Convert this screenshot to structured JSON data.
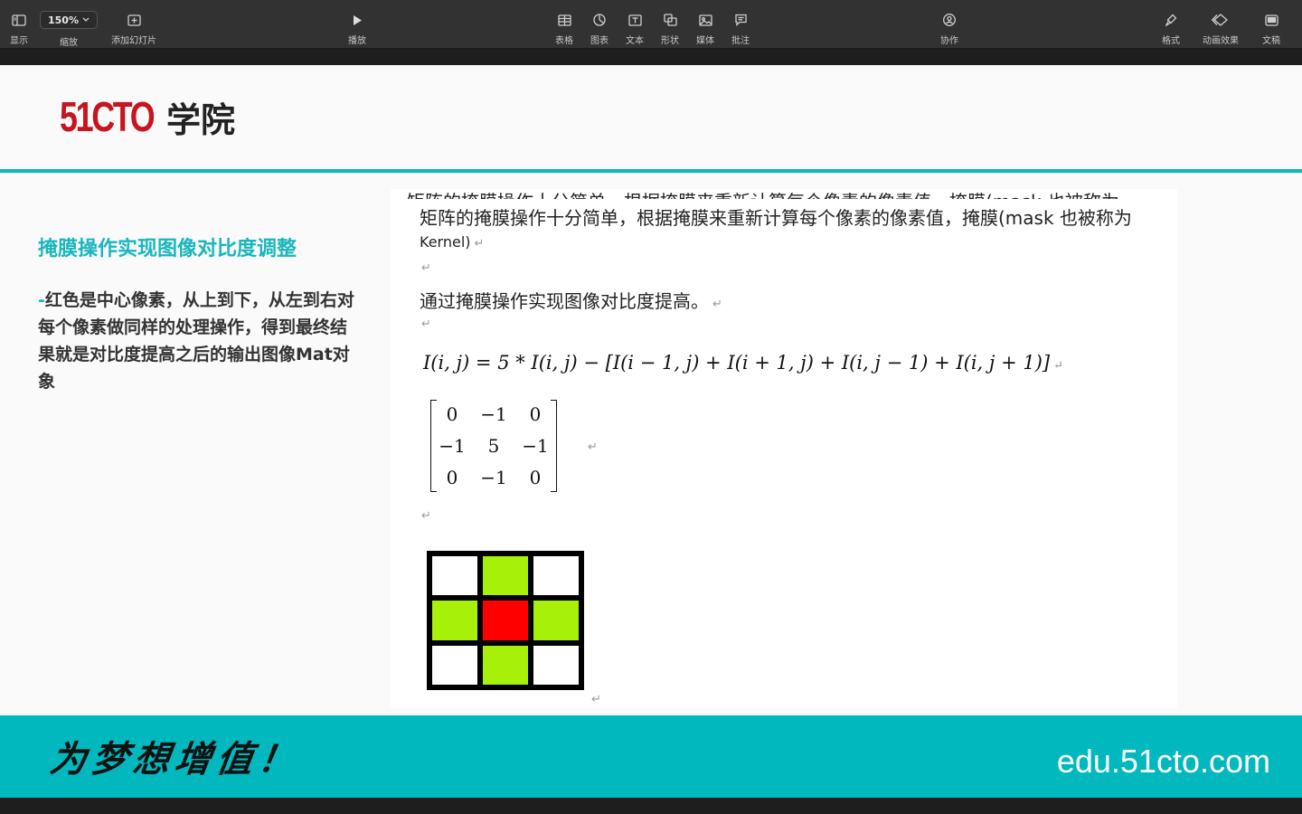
{
  "toolbar": {
    "view_label": "显示",
    "zoom_value": "150%",
    "zoom_label": "缩放",
    "add_slide_label": "添加幻灯片",
    "play_label": "播放",
    "table_label": "表格",
    "chart_label": "图表",
    "text_label": "文本",
    "shape_label": "形状",
    "media_label": "媒体",
    "comment_label": "批注",
    "collaborate_label": "协作",
    "format_label": "格式",
    "animate_label": "动画效果",
    "document_label": "文稿"
  },
  "slide": {
    "logo_number": "51CTO",
    "logo_text": "学院",
    "title": "掩膜操作实现图像对比度调整",
    "body_dash": "-",
    "body_text": "红色是中心像素，从上到下，从左到右对每个像素做同样的处理操作，得到最终结果就是对比度提高之后的输出图像Mat对象",
    "doc": {
      "cut_line": "矩阵的掩膜操作十分简单，根据掩膜来重新计算每个像素的像素值，掩膜(mask 也被称为",
      "line1": "矩阵的掩膜操作十分简单，根据掩膜来重新计算每个像素的像素值，掩膜(mask 也被称为",
      "line2": "Kernel)",
      "line3": "通过掩膜操作实现图像对比度提高。",
      "return_mark": "↵",
      "formula": "I(i, j) = 5 * I(i, j) − [I(i − 1, j) + I(i + 1, j) + I(i, j − 1) + I(i, j + 1)]",
      "matrix": [
        "0",
        "−1",
        "0",
        "−1",
        "5",
        "−1",
        "0",
        "−1",
        "0"
      ],
      "grid_colors": [
        "#ffffff",
        "#a6f00a",
        "#ffffff",
        "#a6f00a",
        "#ff0000",
        "#a6f00a",
        "#ffffff",
        "#a6f00a",
        "#ffffff"
      ]
    },
    "footer_slogan": "为梦想增值！",
    "footer_site": "edu.51cto.com"
  }
}
